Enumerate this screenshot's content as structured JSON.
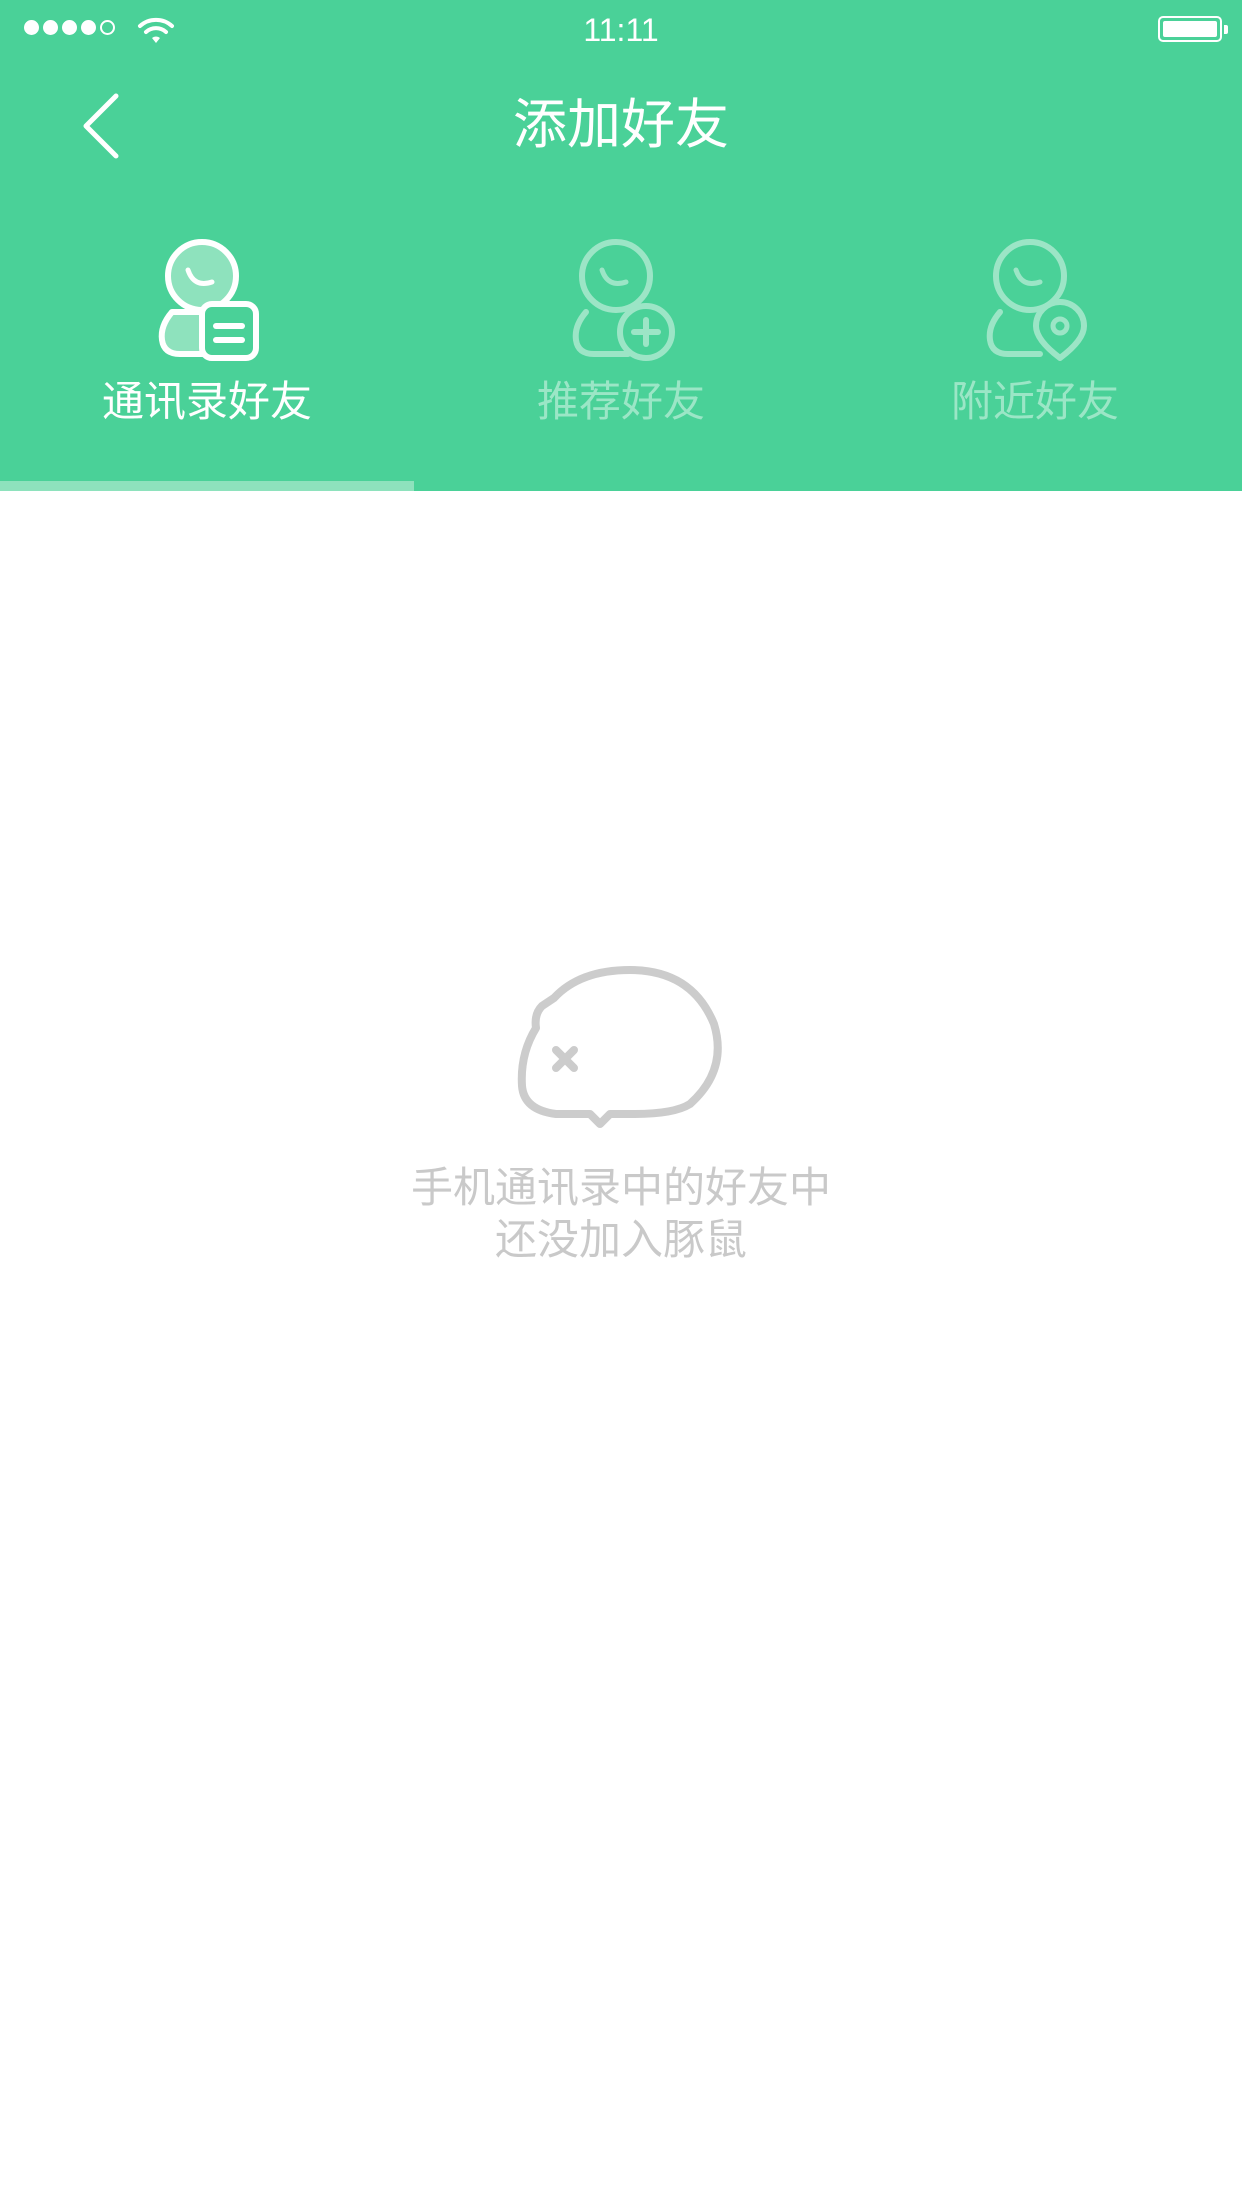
{
  "status_bar": {
    "time": "11:11",
    "signal_bars_filled": 4,
    "signal_bars_total": 5,
    "battery_level": 1.0
  },
  "nav": {
    "title": "添加好友",
    "back_icon": "chevron-left-icon"
  },
  "tabs": [
    {
      "label": "通讯录好友",
      "icon": "contact-book-user-icon",
      "active": true
    },
    {
      "label": "推荐好友",
      "icon": "add-user-icon",
      "active": false
    },
    {
      "label": "附近好友",
      "icon": "location-user-icon",
      "active": false
    }
  ],
  "empty_state": {
    "icon": "hamster-icon",
    "line1": "手机通讯录中的好友中",
    "line2": "还没加入豚鼠"
  },
  "colors": {
    "header_bg": "#4ad198",
    "indicator": "#8ee2bd",
    "empty_text": "#c9c9c9",
    "empty_icon": "#cccccc"
  }
}
